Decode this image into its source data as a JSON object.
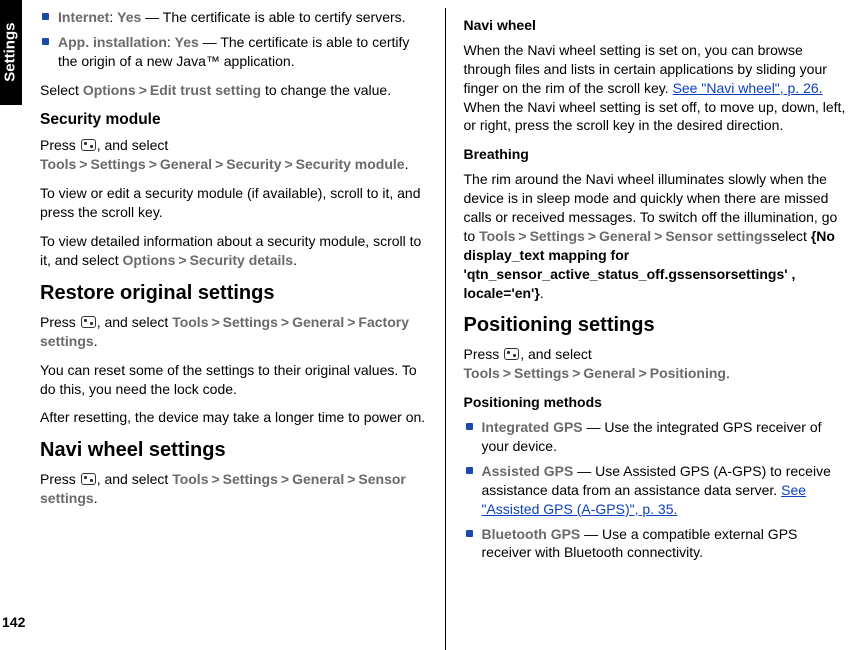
{
  "sideTab": "Settings",
  "pageNumber": "142",
  "left": {
    "bullets": [
      {
        "label": "Internet",
        "value": "Yes",
        "desc": " — The certificate is able to certify servers."
      },
      {
        "label": "App. installation",
        "value": "Yes",
        "desc": " — The certificate is able to certify the origin of a new Java™ application."
      }
    ],
    "selectPrefix": "Select ",
    "options": "Options",
    "editTrust": "Edit trust setting",
    "selectSuffix": " to change the value.",
    "secModuleHeading": "Security module",
    "pressPrefix": "Press ",
    "andSelect": ", and select ",
    "tools": "Tools",
    "settings": "Settings",
    "general": "General",
    "security": "Security",
    "securityModule": "Security module",
    "secModP1": "To view or edit a security module (if available), scroll to it, and press the scroll key.",
    "secModP2a": "To view detailed information about a security module, scroll to it, and select ",
    "securityDetails": "Security details",
    "restoreHeading": "Restore original settings",
    "factorySettings": "Factory settings",
    "restoreP1": "You can reset some of the settings to their original values. To do this, you need the lock code.",
    "restoreP2": "After resetting, the device may take a longer time to power on.",
    "naviWheelHeading": "Navi wheel settings",
    "sensorSettings": "Sensor settings"
  },
  "right": {
    "naviWheelSub": "Navi wheel",
    "naviP1a": "When the Navi wheel setting is set on, you can browse through files and lists in certain applications by sliding your finger on the rim of the scroll key. ",
    "naviLink": "See \"Navi wheel\", p. 26.",
    "naviP1b": " When the Navi wheel setting is set off, to move up, down, left, or right, press the scroll key in the desired direction.",
    "breathingSub": "Breathing",
    "breathP1a": "The rim around the Navi wheel illuminates slowly when the device is in sleep mode and quickly when there are missed calls or received messages. To switch off the illumination, go to ",
    "tools": "Tools",
    "settings": "Settings",
    "general": "General",
    "sensorSettings": "Sensor settings",
    "breathP1b": "select ",
    "breathErr": "{No display_text mapping for 'qtn_sensor_active_status_off.gssensorsettings' , locale='en'}",
    "posHeading": "Positioning settings",
    "pressPrefix": "Press ",
    "andSelect": ", and select ",
    "positioning": "Positioning",
    "posMethodsSub": "Positioning methods",
    "posBullets": [
      {
        "label": "Integrated GPS",
        "desc": " — Use the integrated GPS receiver of your device."
      },
      {
        "label": "Assisted GPS",
        "desc": " — Use Assisted GPS (A-GPS) to receive assistance data from an assistance data server. ",
        "link": "See \"Assisted GPS (A-GPS)\", p. 35."
      },
      {
        "label": "Bluetooth GPS",
        "desc": " — Use a compatible external GPS receiver with Bluetooth connectivity."
      }
    ]
  }
}
